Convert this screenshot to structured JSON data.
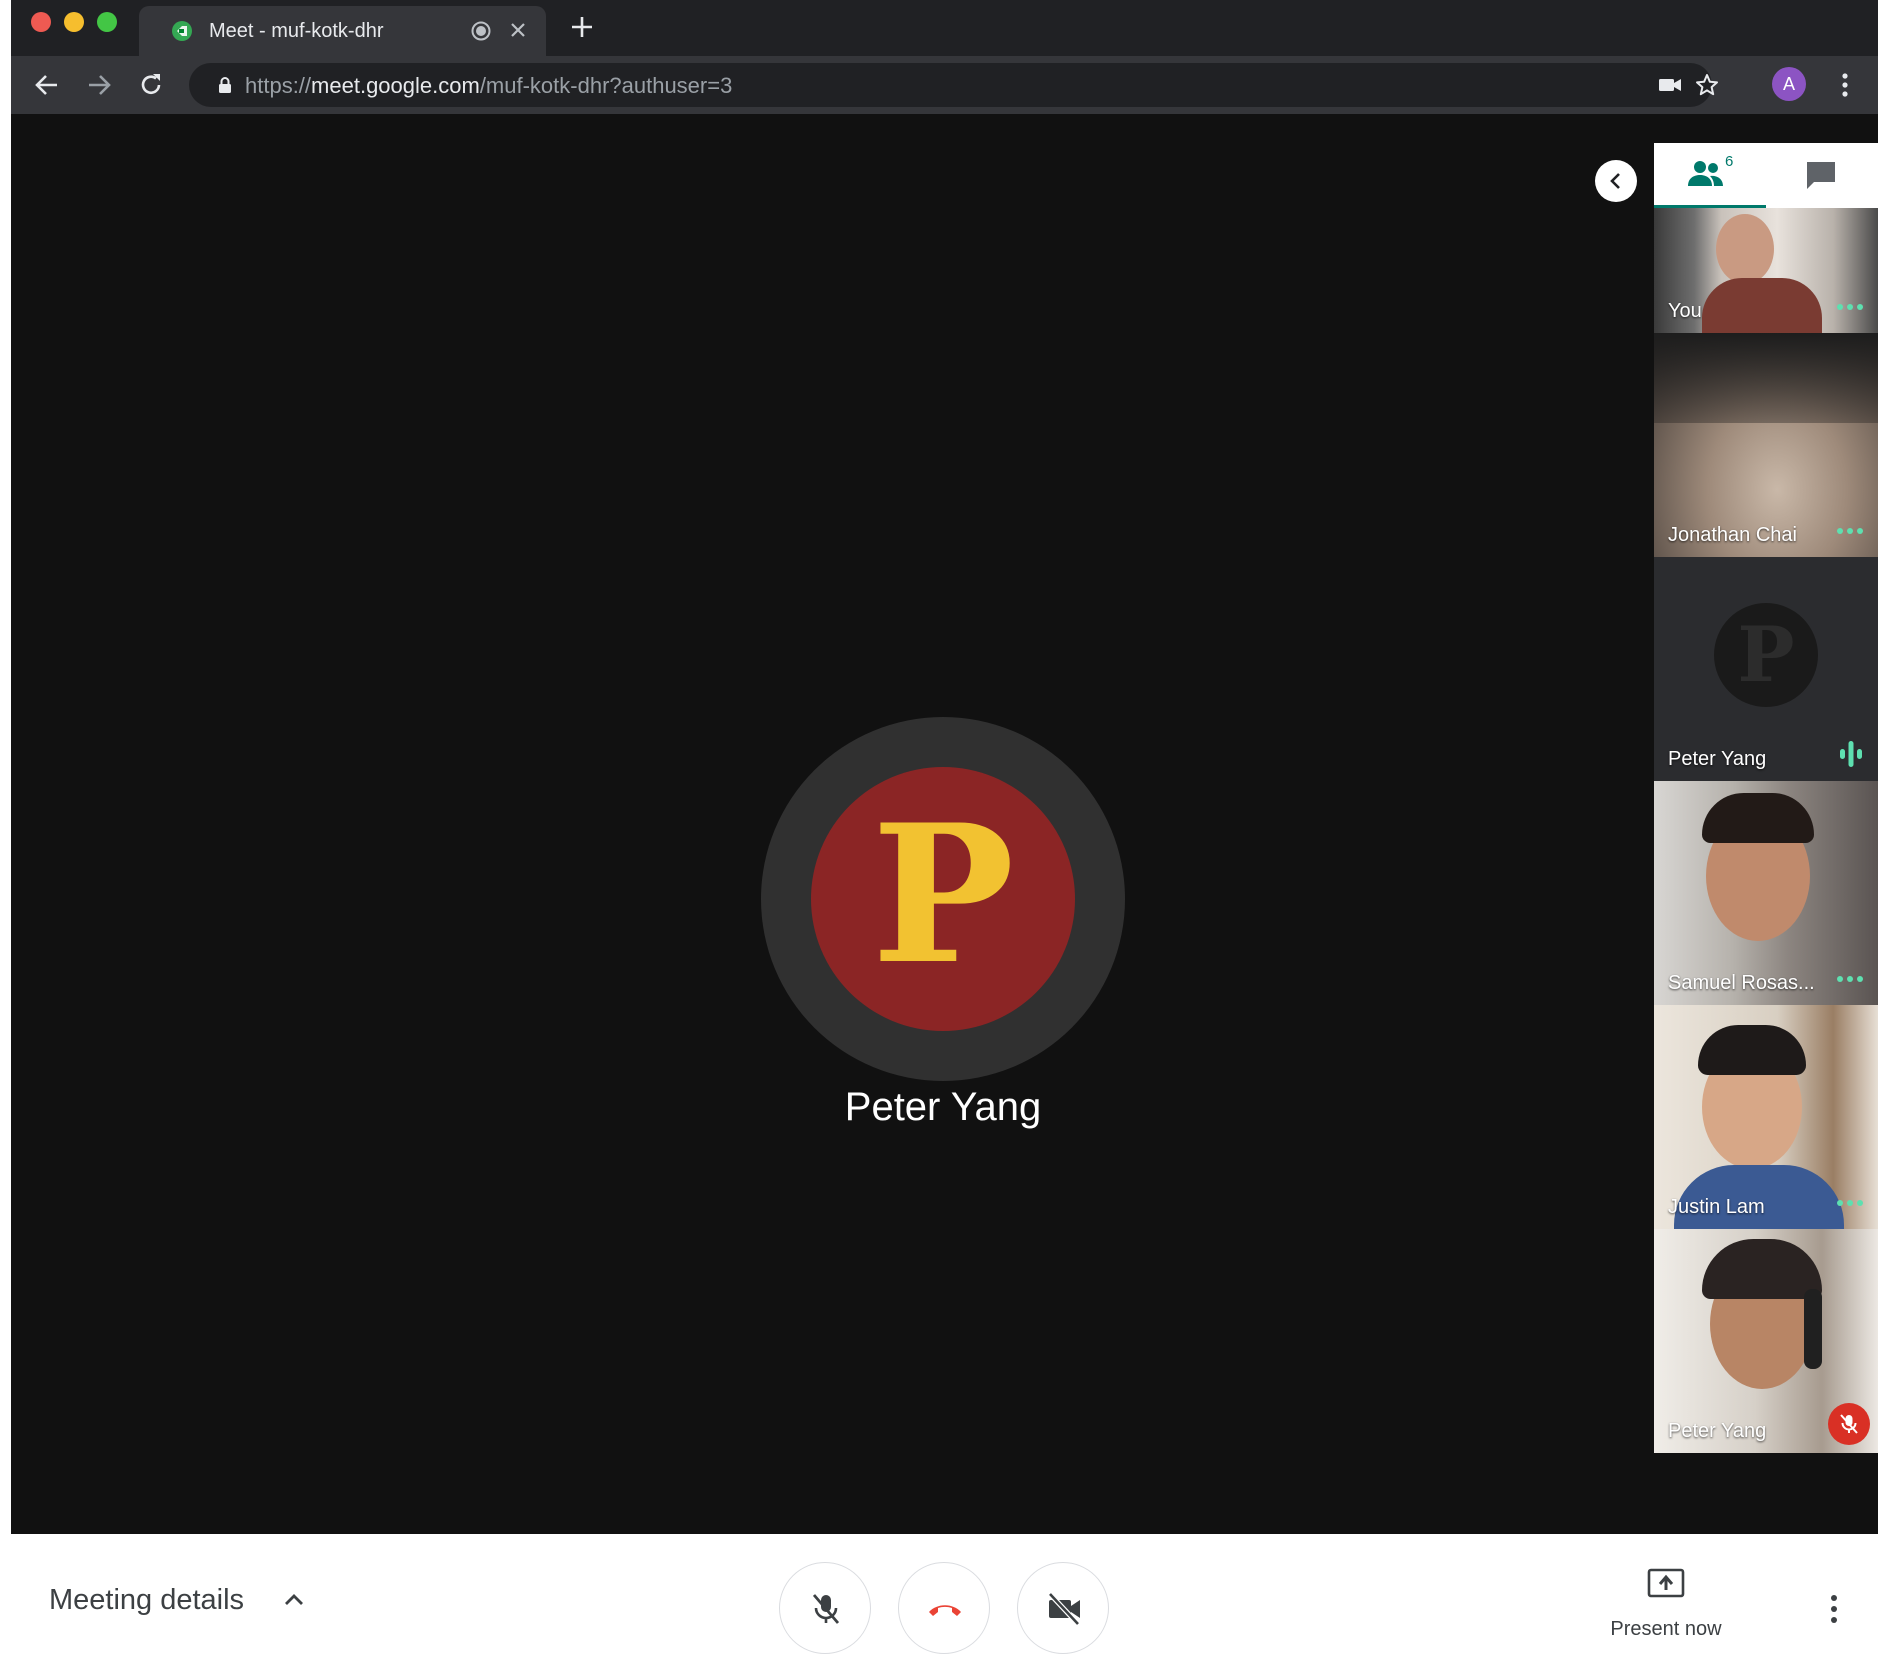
{
  "browser": {
    "tab_title": "Meet - muf-kotk-dhr",
    "url_scheme": "https://",
    "url_host": "meet.google.com",
    "url_path": "/muf-kotk-dhr?authuser=3",
    "profile_initial": "A"
  },
  "stage": {
    "avatar_letter": "P",
    "speaker_name": "Peter Yang"
  },
  "panel": {
    "participant_count": "6",
    "tiles": [
      {
        "name": "You",
        "status": "more-options"
      },
      {
        "name": "Jonathan Chai",
        "status": "more-options"
      },
      {
        "name": "Peter Yang",
        "avatar_letter": "P",
        "status": "speaking"
      },
      {
        "name": "Samuel Rosas...",
        "status": "more-options"
      },
      {
        "name": "Justin Lam",
        "status": "more-options"
      },
      {
        "name": "Peter Yang",
        "status": "muted"
      }
    ]
  },
  "bottom": {
    "meeting_details": "Meeting details",
    "present_now": "Present now"
  },
  "colors": {
    "meet_teal": "#00796b",
    "hangup_red": "#ea4335",
    "avatar_red": "#8b2525",
    "avatar_yellow": "#f2c231",
    "speaking_green": "#5ee0b0"
  }
}
